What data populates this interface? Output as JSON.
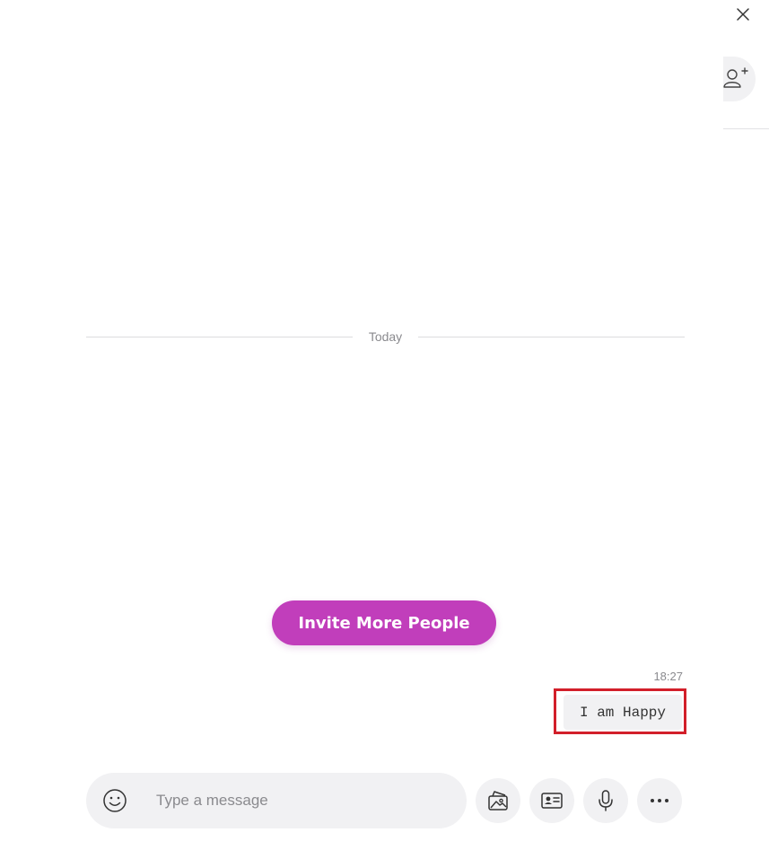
{
  "header": {
    "close_icon": "close-icon",
    "add_person_icon": "add-person-icon"
  },
  "conversation": {
    "date_divider": "Today",
    "invite_button_label": "Invite More People",
    "messages": [
      {
        "time": "18:27",
        "text": "I am Happy",
        "highlight_color": "#d21f2a"
      }
    ]
  },
  "composer": {
    "placeholder": "Type a message",
    "value": "",
    "tools": [
      "emoji-icon",
      "media-gallery-icon",
      "contact-card-icon",
      "microphone-icon",
      "more-options-icon"
    ]
  },
  "colors": {
    "accent": "#c13ebb",
    "surface": "#f1f1f3",
    "muted_text": "#8a8a8e",
    "highlight": "#d21f2a"
  }
}
